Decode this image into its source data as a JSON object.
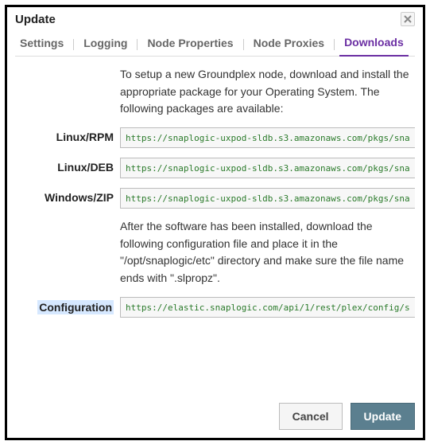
{
  "dialog": {
    "title": "Update",
    "close_aria": "Close"
  },
  "tabs": {
    "settings": "Settings",
    "logging": "Logging",
    "node_properties": "Node Properties",
    "node_proxies": "Node Proxies",
    "downloads": "Downloads",
    "active": "downloads"
  },
  "intro_text": "To setup a new Groundplex node, download and install the appropriate package for your Operating System. The following packages are available:",
  "packages": {
    "linux_rpm": {
      "label": "Linux/RPM",
      "url": "https://snaplogic-uxpod-sldb.s3.amazonaws.com/pkgs/sna"
    },
    "linux_deb": {
      "label": "Linux/DEB",
      "url": "https://snaplogic-uxpod-sldb.s3.amazonaws.com/pkgs/sna"
    },
    "windows_zip": {
      "label": "Windows/ZIP",
      "url": "https://snaplogic-uxpod-sldb.s3.amazonaws.com/pkgs/sna"
    }
  },
  "config_text": "After the software has been installed, download the following configuration file and place it in the \"/opt/snaplogic/etc\" directory and make sure the file name ends with \".slpropz\".",
  "configuration": {
    "label": "Configuration",
    "url": "https://elastic.snaplogic.com/api/1/rest/plex/config/s"
  },
  "footer": {
    "cancel": "Cancel",
    "update": "Update"
  },
  "icons": {
    "copy": "copy-icon",
    "download": "download-icon",
    "close": "close-icon"
  }
}
